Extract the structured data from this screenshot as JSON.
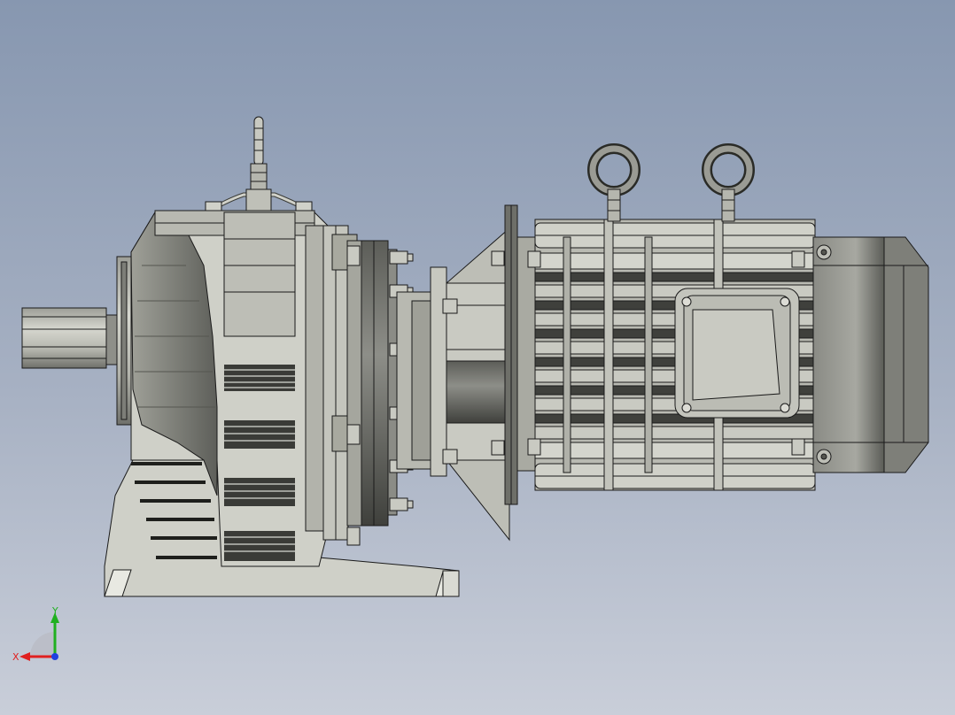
{
  "viewport": {
    "background_top": "#8797b0",
    "background_bottom": "#c9ced9"
  },
  "triad": {
    "x_label": "X",
    "y_label": "Y",
    "x_color": "#e02020",
    "y_color": "#20b020",
    "z_color": "#2040e0"
  },
  "model": {
    "outline_color": "#1a1a1a",
    "light_fill": "#cfd0c8",
    "mid_fill": "#a9aaa2",
    "dark_fill": "#6e6f69"
  }
}
